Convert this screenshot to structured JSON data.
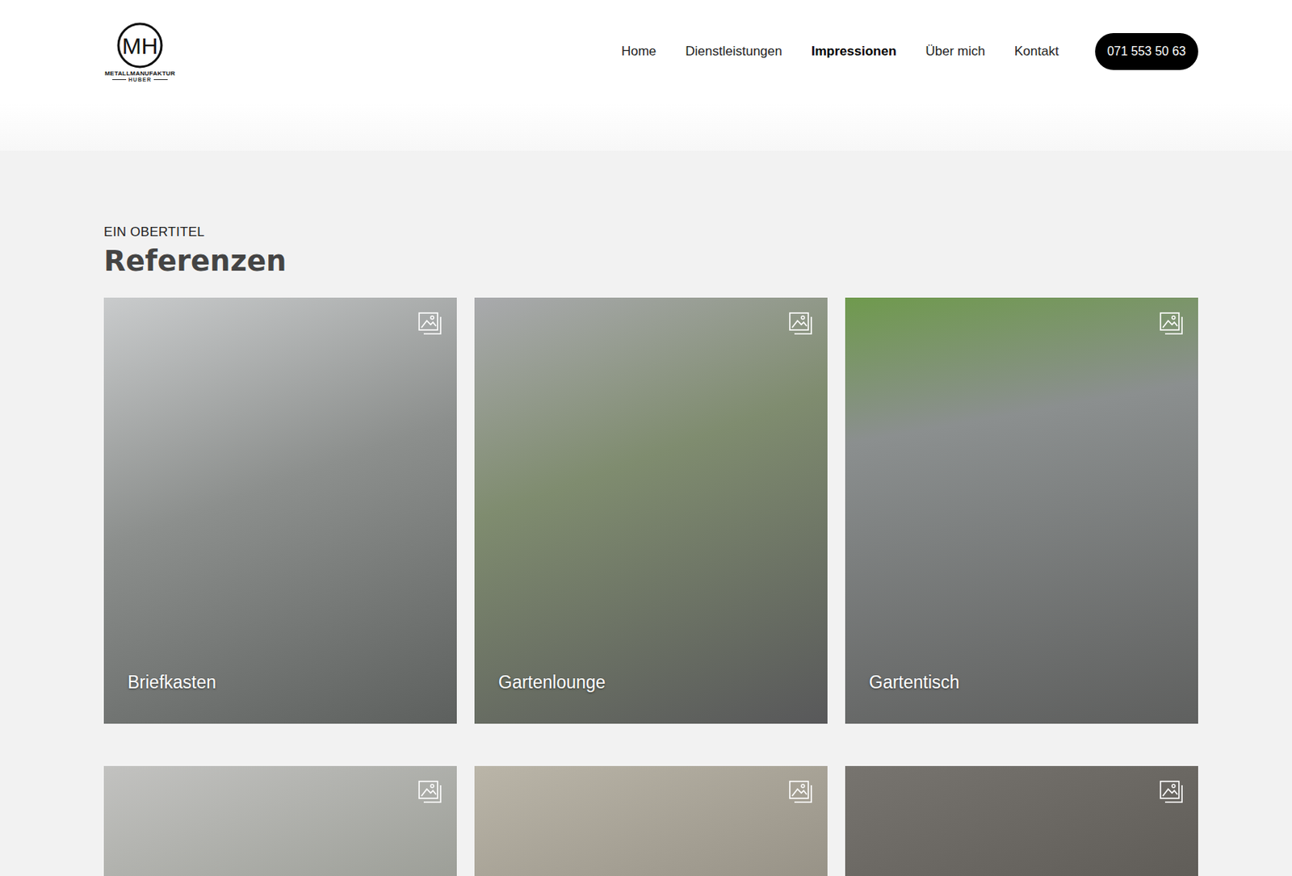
{
  "logo": {
    "mark": "MH",
    "name": "METALLMANUFAKTUR",
    "sub": "HUBER"
  },
  "nav": [
    {
      "label": "Home",
      "selected": false
    },
    {
      "label": "Dienstleistungen",
      "selected": false
    },
    {
      "label": "Impressionen",
      "selected": true
    },
    {
      "label": "Über mich",
      "selected": false
    },
    {
      "label": "Kontakt",
      "selected": false
    }
  ],
  "phone": "071 553 50 63",
  "section": {
    "overline": "EIN OBERTITEL",
    "title": "Referenzen"
  },
  "cards": [
    {
      "label": "Briefkasten"
    },
    {
      "label": "Gartenlounge"
    },
    {
      "label": "Gartentisch"
    },
    {
      "label": ""
    },
    {
      "label": ""
    },
    {
      "label": ""
    }
  ]
}
